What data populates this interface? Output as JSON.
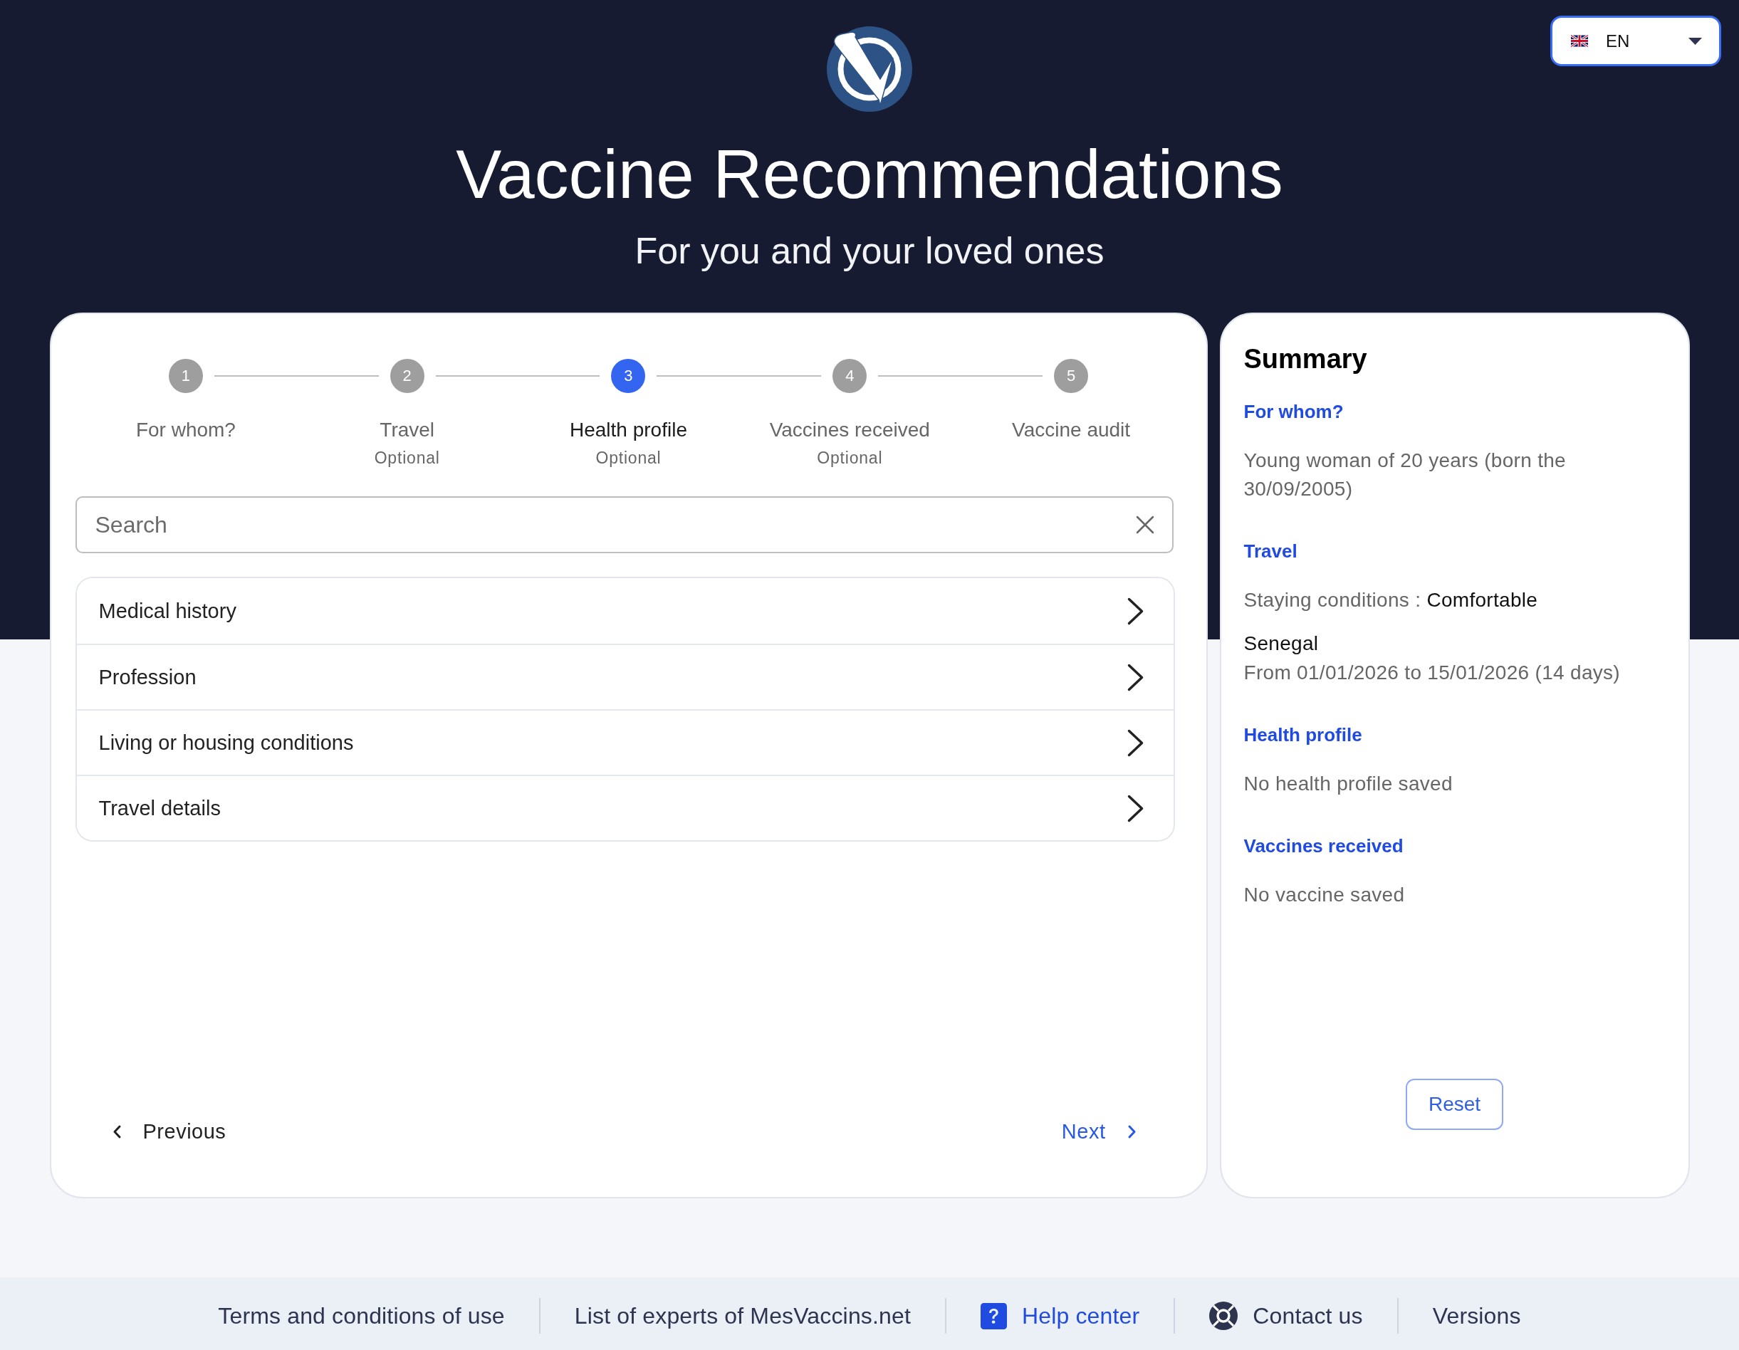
{
  "language_selector": {
    "value": "EN"
  },
  "header": {
    "title": "Vaccine Recommendations",
    "subtitle": "For you and your loved ones"
  },
  "stepper": [
    {
      "number": "1",
      "label": "For whom?",
      "selected": false
    },
    {
      "number": "2",
      "label": "Travel",
      "sublabel": "Optional",
      "selected": false
    },
    {
      "number": "3",
      "label": "Health profile",
      "sublabel": "Optional",
      "selected": true
    },
    {
      "number": "4",
      "label": "Vaccines received",
      "sublabel": "Optional",
      "selected": false
    },
    {
      "number": "5",
      "label": "Vaccine audit",
      "selected": false
    }
  ],
  "search": {
    "placeholder": "Search"
  },
  "categories": [
    {
      "label": "Medical history"
    },
    {
      "label": "Profession"
    },
    {
      "label": "Living or housing conditions"
    },
    {
      "label": "Travel details"
    }
  ],
  "navigation": {
    "previous": "Previous",
    "next": "Next"
  },
  "summary": {
    "title": "Summary",
    "sections": [
      {
        "heading": "For whom?",
        "items": [
          {
            "kind": "text",
            "text": "Young woman of 20 years (born the 30/09/2005)"
          }
        ]
      },
      {
        "heading": "Travel",
        "items": [
          {
            "kind": "field",
            "label": "Staying conditions :",
            "value": "Comfortable"
          },
          {
            "kind": "destination",
            "country": "Senegal",
            "dates": "From 01/01/2026 to 15/01/2026 (14 days)"
          }
        ]
      },
      {
        "heading": "Health profile",
        "items": [
          {
            "kind": "text",
            "text": "No health profile saved"
          }
        ]
      },
      {
        "heading": "Vaccines received",
        "items": [
          {
            "kind": "text",
            "text": "No vaccine saved"
          }
        ]
      }
    ],
    "reset_button": "Reset"
  },
  "footer": {
    "links": [
      {
        "label": "Terms and conditions of use",
        "kind": "link"
      },
      {
        "label": "List of experts of MesVaccins.net",
        "kind": "link"
      },
      {
        "label": "Help center",
        "kind": "help"
      },
      {
        "label": "Contact us",
        "kind": "contact"
      },
      {
        "label": "Versions",
        "kind": "link"
      }
    ]
  }
}
